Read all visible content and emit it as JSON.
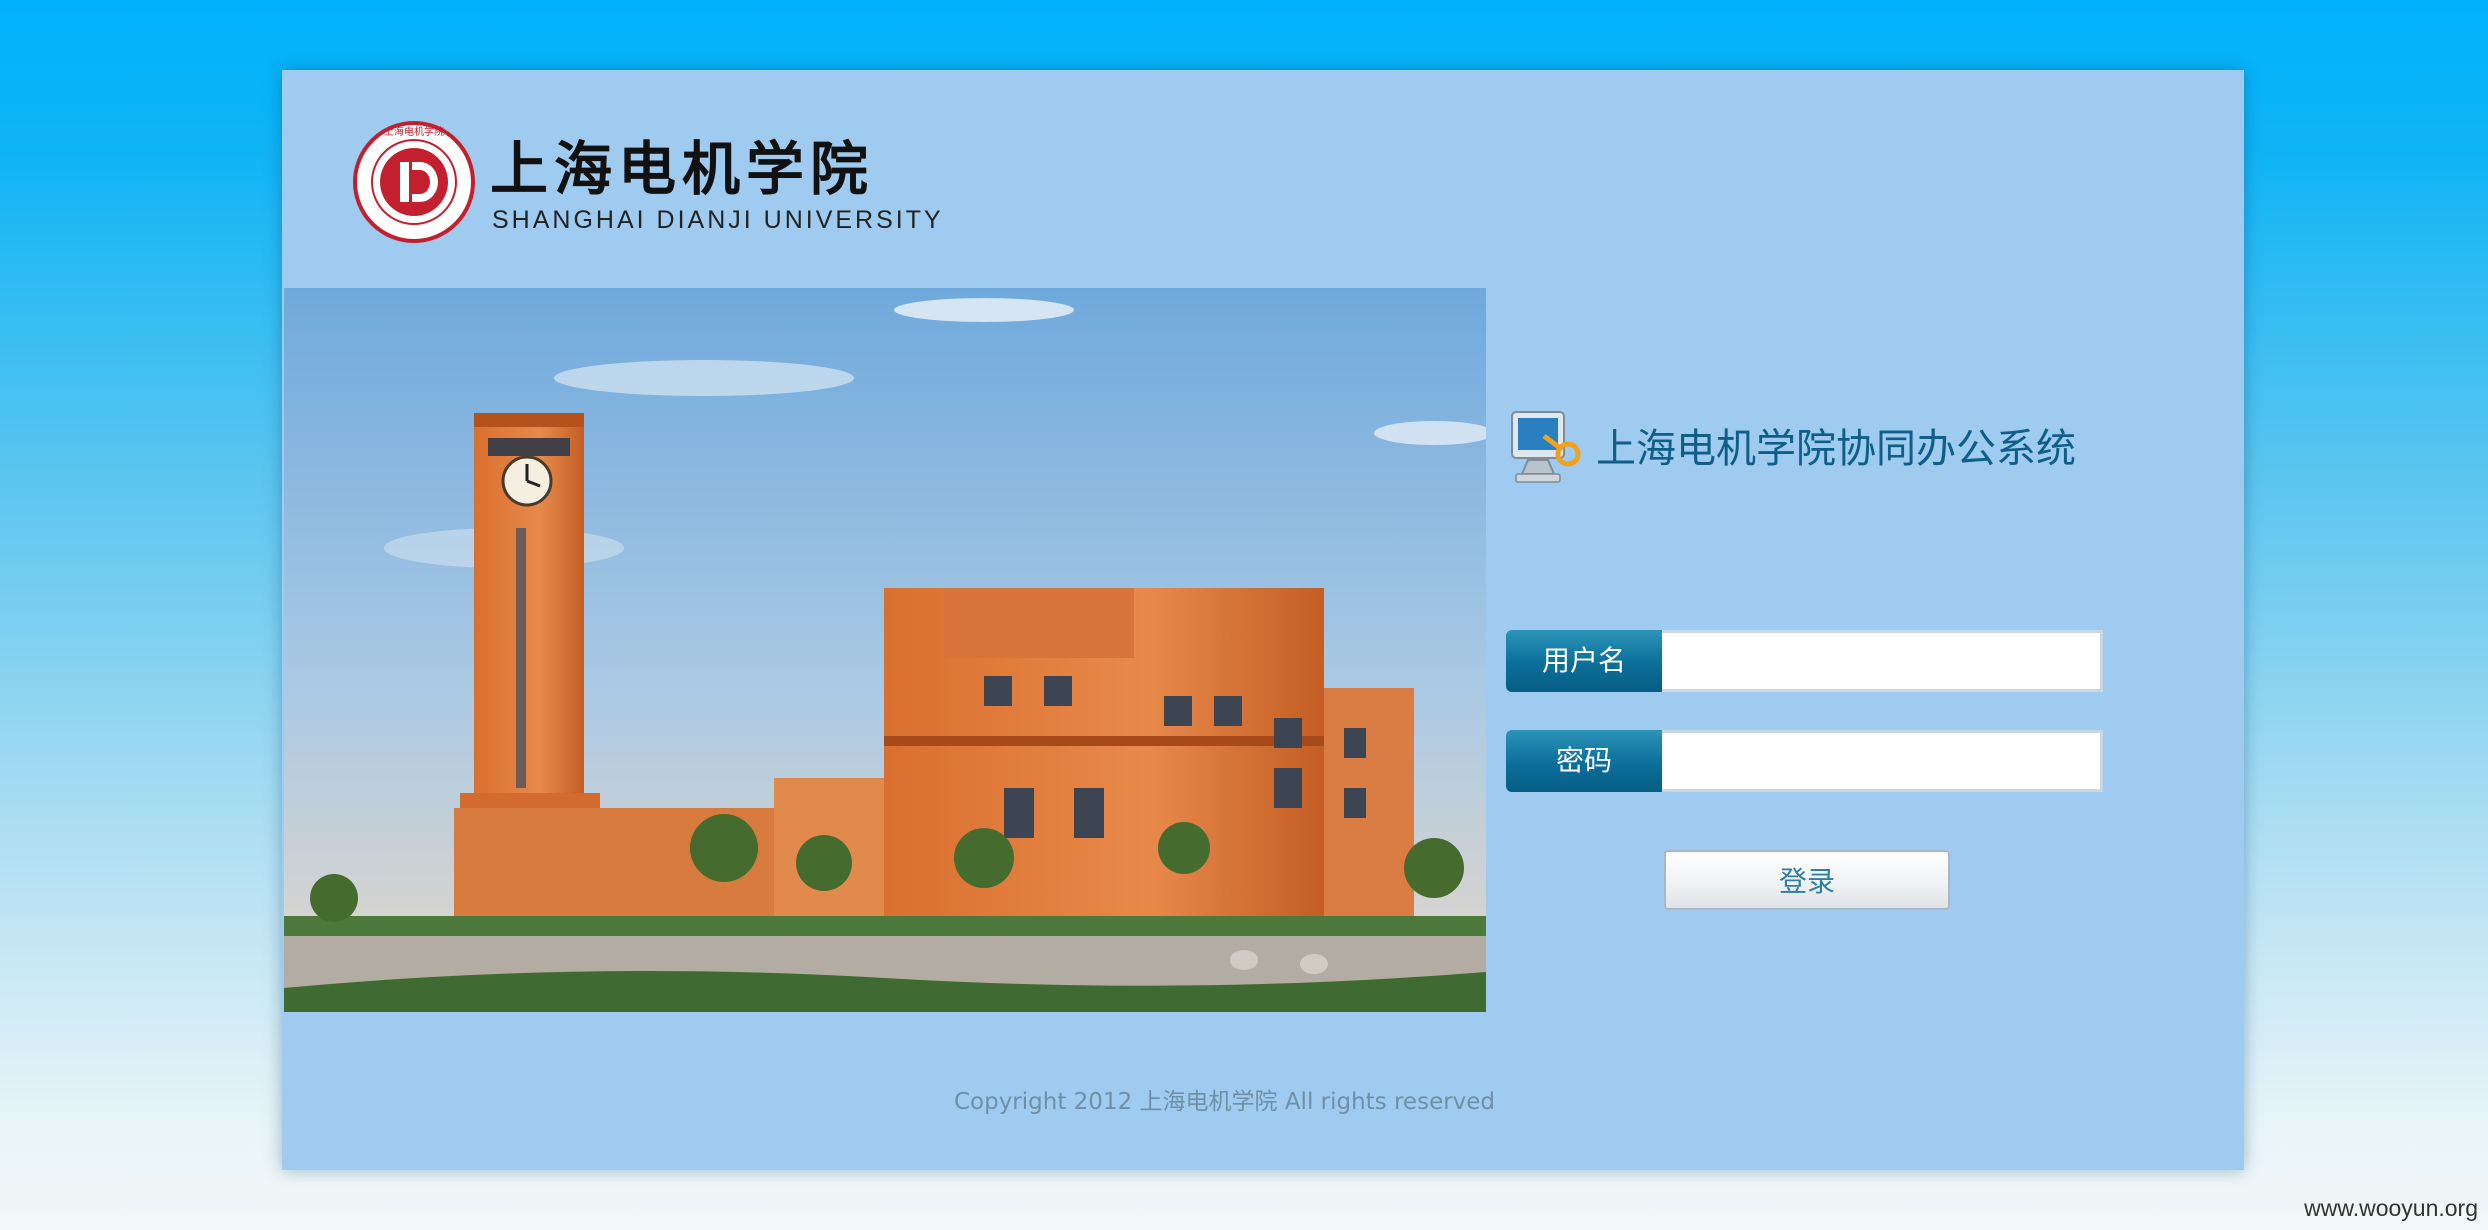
{
  "brand": {
    "seal_text": "上海电机学院",
    "name_cn": "上海电机学院",
    "name_en": "SHANGHAI DIANJI UNIVERSITY"
  },
  "login": {
    "system_title": "上海电机学院协同办公系统",
    "username_label": "用户名",
    "username_value": "",
    "password_label": "密码",
    "password_value": "",
    "submit_label": "登录"
  },
  "footer": {
    "copyright": "Copyright 2012 上海电机学院 All rights reserved"
  },
  "watermark": "www.wooyun.org",
  "colors": {
    "page_top": "#00b2fb",
    "panel": "#9ecbef",
    "label_bg": "#0b6f99",
    "title_text": "#0f5e87",
    "seal_red": "#c2202f"
  }
}
